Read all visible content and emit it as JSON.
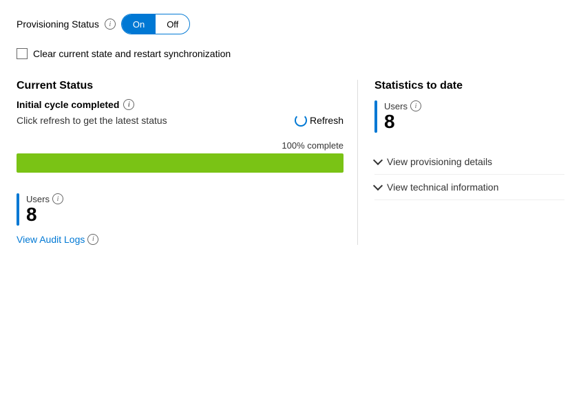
{
  "provisioning": {
    "status_label": "Provisioning Status",
    "info_icon": "i",
    "toggle_on": "On",
    "toggle_off": "Off"
  },
  "checkbox": {
    "label": "Clear current state and restart synchronization"
  },
  "current_status": {
    "title": "Current Status",
    "initial_cycle": "Initial cycle completed",
    "info_icon": "i",
    "refresh_prompt": "Click refresh to get the latest status",
    "refresh_label": "Refresh",
    "progress_label": "100% complete",
    "progress_percent": 100
  },
  "bottom": {
    "users_label": "Users",
    "users_info_icon": "i",
    "users_count": "8",
    "audit_link": "View Audit Logs",
    "audit_info_icon": "i"
  },
  "statistics": {
    "title": "Statistics to date",
    "users_label": "Users",
    "users_info_icon": "i",
    "users_count": "8"
  },
  "expand_rows": [
    {
      "label": "View provisioning details"
    },
    {
      "label": "View technical information"
    }
  ],
  "colors": {
    "accent": "#0078d4",
    "progress_fill": "#7ac315"
  }
}
